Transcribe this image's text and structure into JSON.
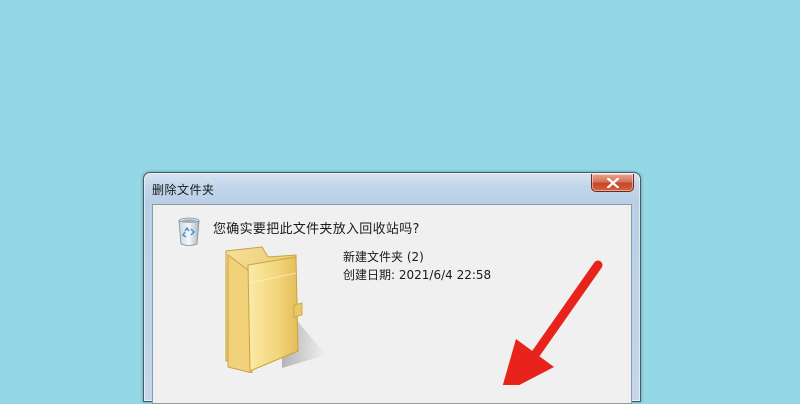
{
  "dialog": {
    "title": "删除文件夹",
    "question": "您确实要把此文件夹放入回收站吗?",
    "item": {
      "name": "新建文件夹 (2)",
      "created": "创建日期: 2021/6/4 22:58"
    }
  },
  "icons": {
    "close": "close-icon",
    "recycle_bin": "recycle-bin-icon",
    "folder": "folder-icon",
    "pointer": "red-arrow-annotation"
  },
  "colors": {
    "background": "#94d8e8",
    "close_button": "#c5462a",
    "arrow": "#e8231c",
    "folder": "#f3d57a"
  }
}
